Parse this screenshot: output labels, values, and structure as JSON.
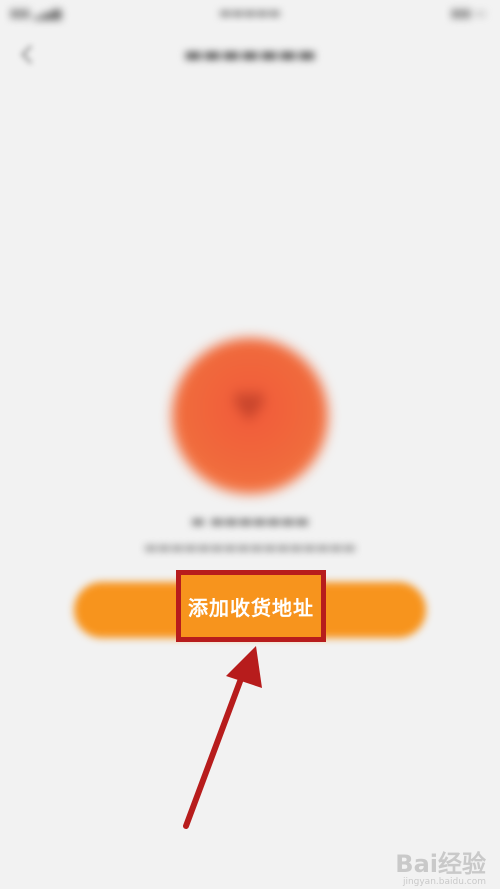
{
  "cta": {
    "label": "添加收货地址"
  },
  "watermark": {
    "brand": "Bai经验",
    "url": "jingyan.baidu.com"
  },
  "colors": {
    "accent_orange": "#f7941d",
    "highlight_red": "#b71c1c",
    "empty_icon": "#f06a3c",
    "background": "#f2f2f2"
  },
  "icons": {
    "back": "back-chevron-icon",
    "empty_state": "location-pin-icon",
    "annotation": "annotation-arrow"
  }
}
